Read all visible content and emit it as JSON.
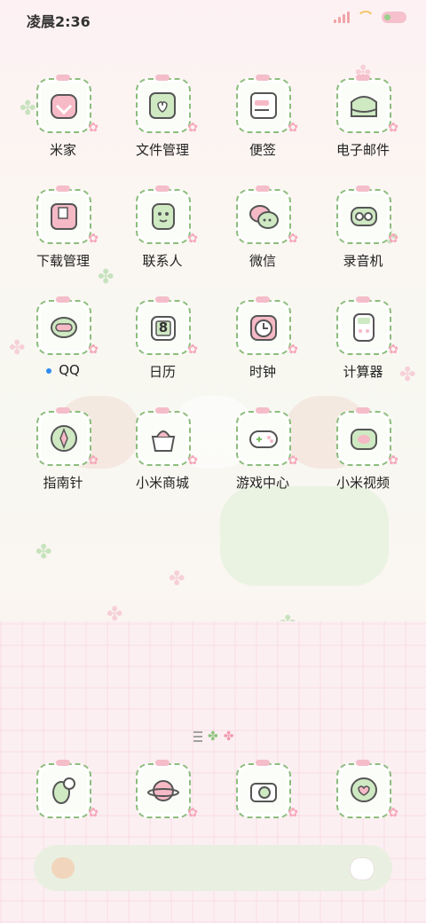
{
  "status_bar": {
    "time": "凌晨2:36"
  },
  "apps": [
    {
      "label": "米家",
      "icon": "mijia-icon"
    },
    {
      "label": "文件管理",
      "icon": "file-manager-icon"
    },
    {
      "label": "便签",
      "icon": "notes-icon"
    },
    {
      "label": "电子邮件",
      "icon": "email-icon"
    },
    {
      "label": "下载管理",
      "icon": "download-manager-icon"
    },
    {
      "label": "联系人",
      "icon": "contacts-icon"
    },
    {
      "label": "微信",
      "icon": "wechat-icon"
    },
    {
      "label": "录音机",
      "icon": "recorder-icon"
    },
    {
      "label": "QQ",
      "icon": "qq-icon",
      "notification_dot": true
    },
    {
      "label": "日历",
      "icon": "calendar-icon",
      "badge": "8"
    },
    {
      "label": "时钟",
      "icon": "clock-icon"
    },
    {
      "label": "计算器",
      "icon": "calculator-icon"
    },
    {
      "label": "指南针",
      "icon": "compass-icon"
    },
    {
      "label": "小米商城",
      "icon": "mi-store-icon"
    },
    {
      "label": "游戏中心",
      "icon": "game-center-icon"
    },
    {
      "label": "小米视频",
      "icon": "mi-video-icon"
    }
  ],
  "dock": [
    {
      "icon": "phone-icon"
    },
    {
      "icon": "browser-planet-icon"
    },
    {
      "icon": "camera-icon"
    },
    {
      "icon": "messages-icon"
    }
  ],
  "colors": {
    "tile_border": "#8cbd7d",
    "accent_pink": "#f4bdc9",
    "notification_dot": "#2f8bf0"
  }
}
